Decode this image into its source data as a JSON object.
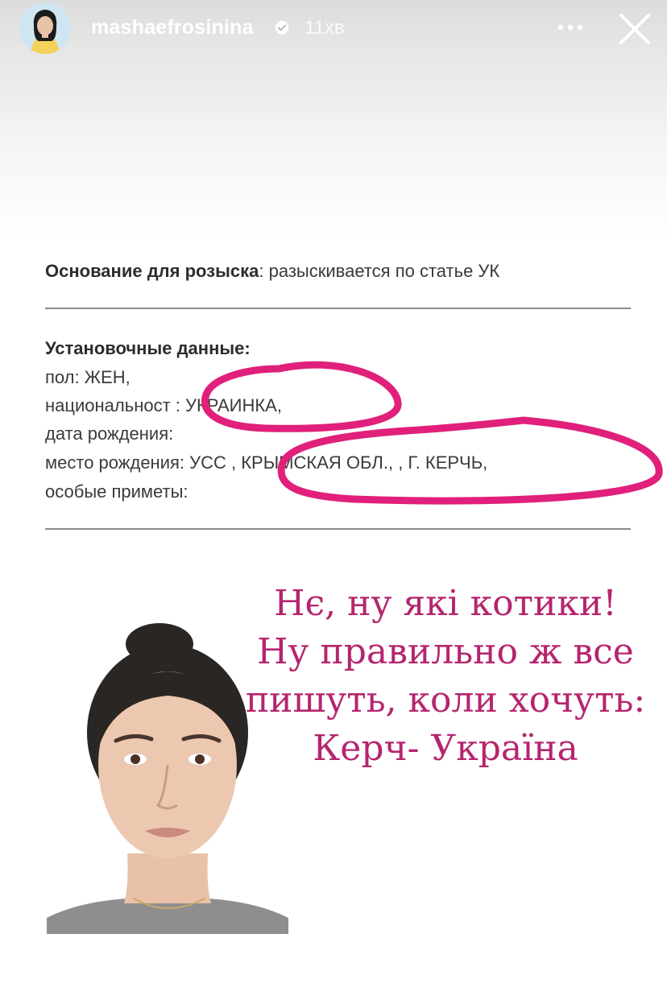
{
  "header": {
    "username": "mashaefrosinina",
    "time": "11хв",
    "more_icon": "more-horizontal-icon",
    "close_icon": "close-icon",
    "verified_icon": "verified-badge-icon",
    "text_color": "#ffffff"
  },
  "document": {
    "reason_label": "Основание для розыска",
    "reason_value": ": разыскивается по статье УК",
    "section_title": "Установочные данные:",
    "fields": [
      "пол: ЖЕН,",
      "национальност : УКРАИНКА,",
      "дата рождения: ",
      "место рождения: УСС , КРЫМСКАЯ ОБЛ., , Г. КЕРЧЬ,",
      "особые приметы:"
    ],
    "highlight_color": "#e0207a"
  },
  "overlay": {
    "lines": [
      "Нє, ну які котики!",
      "Ну правильно ж все",
      "пишуть, коли хочуть:",
      "Керч- Україна"
    ],
    "color": "#b5256e"
  }
}
